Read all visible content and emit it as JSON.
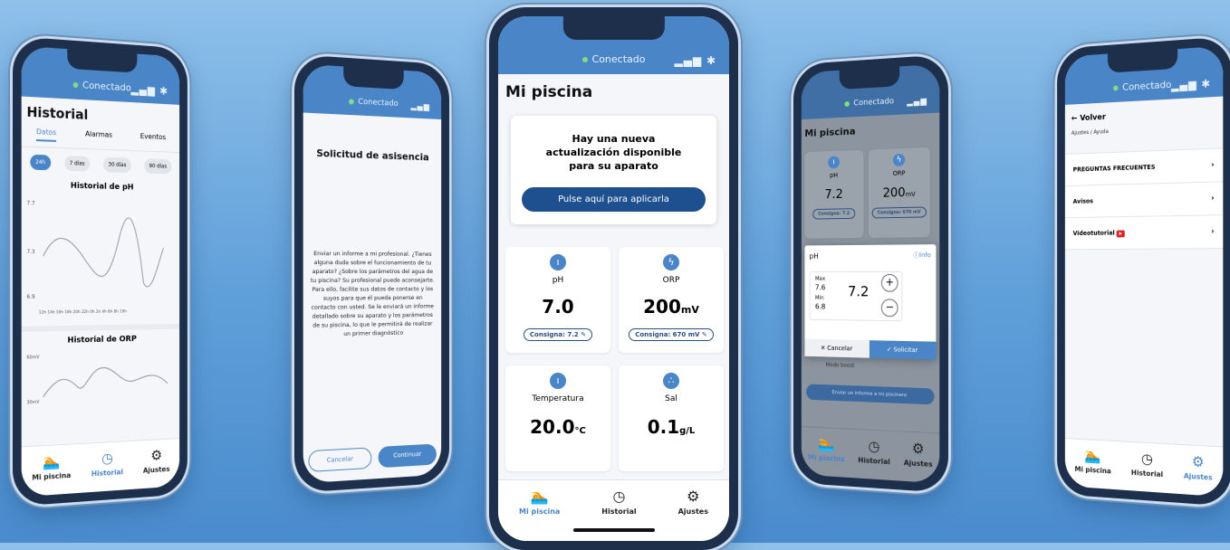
{
  "status": {
    "connected": "Conectado"
  },
  "tabs": {
    "pool": "Mi piscina",
    "history": "Historial",
    "settings": "Ajustes"
  },
  "history_screen": {
    "title": "Historial",
    "subtabs": [
      "Datos",
      "Alarmas",
      "Eventos"
    ],
    "ranges": [
      "24h",
      "7 días",
      "30 días",
      "90 días"
    ],
    "ph_chart_title": "Historial de pH",
    "ph_ticks": [
      "7.7",
      "7.3",
      "6.9"
    ],
    "ph_xticks": "12h 14h 16h 18h 20h 22h 0h 2h 4h 6h 8h 10h",
    "orp_chart_title": "Historial de ORP",
    "orp_ticks": [
      "60mV",
      "30mV"
    ]
  },
  "assist_screen": {
    "title": "Solicitud de asisencia",
    "body": "Enviar un informe a mi profesional. ¿Tienes alguna duda sobre el funcionamiento de tu aparato? ¿Sobre los parámetros del agua de tu piscina? Su profesional puede aconsejarte. Para ello, facilite sus datos de contacto y los suyos para que él pueda ponerse en contacto con usted. Se le enviará un informe detallado sobre su aparato y los parámetros de su piscina, lo que le permitirá de realizar un primer diagnóstico",
    "cancel": "Cancelar",
    "continue": "Continuar"
  },
  "pool_screen": {
    "title": "Mi piscina",
    "update_text": "Hay una nueva actualización disponible para su aparato",
    "update_button": "Pulse aquí para aplicarla",
    "ph": {
      "label": "pH",
      "value": "7.0",
      "setpoint": "Consigna: 7.2"
    },
    "orp": {
      "label": "ORP",
      "value": "200",
      "unit": "mV",
      "setpoint": "Consigna: 670 mV"
    },
    "temp": {
      "label": "Temperatura",
      "value": "20.0",
      "unit": "°C"
    },
    "salt": {
      "label": "Sal",
      "value": "0.1",
      "unit": "g/L"
    }
  },
  "ph_dialog_screen": {
    "title": "Mi piscina",
    "ph": {
      "label": "pH",
      "value": "7.2",
      "setpoint": "Consigna: 7.2"
    },
    "orp": {
      "label": "ORP",
      "value": "200",
      "unit": "mV",
      "setpoint": "Consigna: 670 mV"
    },
    "dialog": {
      "title": "pH",
      "info": "Info",
      "max_label": "Max",
      "max_value": "7.6",
      "min_label": "Min",
      "min_value": "6.8",
      "value": "7.2",
      "cancel": "Cancelar",
      "confirm": "Solicitar"
    },
    "boost": "Modo boost",
    "report_button": "Enviar un informe a mi piscinero"
  },
  "help_screen": {
    "back": "Volver",
    "breadcrumb": "Ajustes / Ayuda",
    "items": [
      "PREGUNTAS FRECUENTES",
      "Avisos",
      "Videotutorial"
    ]
  }
}
